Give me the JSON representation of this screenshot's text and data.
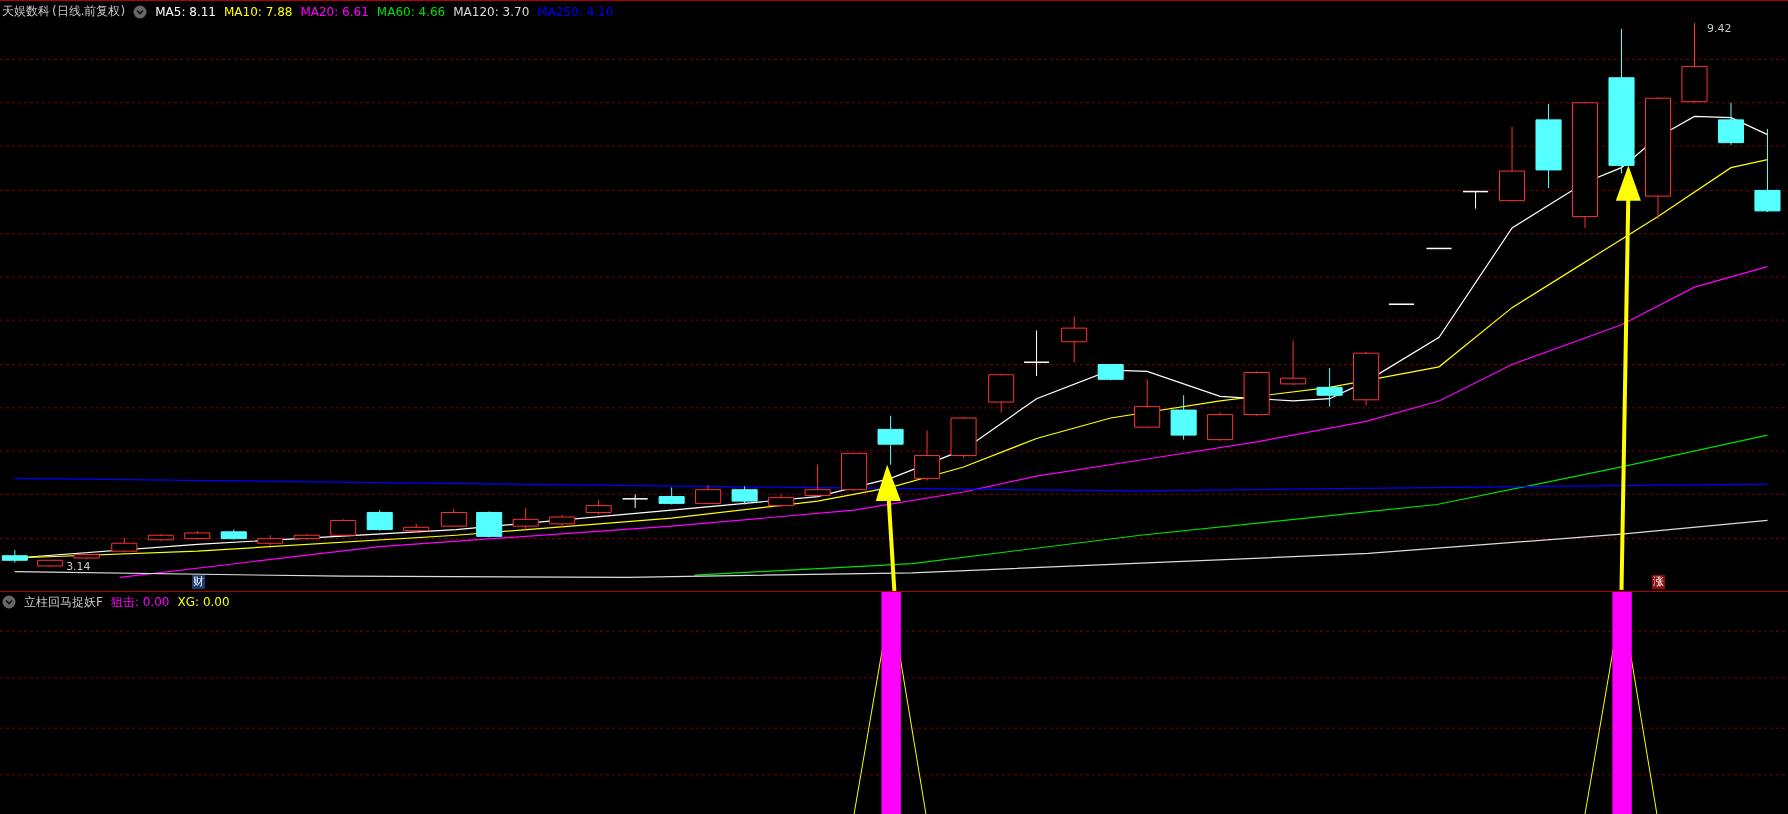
{
  "header": {
    "title": "天娱数科",
    "period": "(日线.前复权)",
    "averages": [
      {
        "label": "MA5:",
        "value": "8.11",
        "color": "#ffffff"
      },
      {
        "label": "MA10:",
        "value": "7.88",
        "color": "#ffff00"
      },
      {
        "label": "MA20:",
        "value": "6.61",
        "color": "#ff00ff"
      },
      {
        "label": "MA60:",
        "value": "4.66",
        "color": "#00e000"
      },
      {
        "label": "MA120:",
        "value": "3.70",
        "color": "#dcdcdc"
      },
      {
        "label": "MA250:",
        "value": "4.10",
        "color": "#0000ff"
      }
    ]
  },
  "main_chart": {
    "high_label": "9.42",
    "low_label": "3.14",
    "signals": [
      {
        "text": "财",
        "kind": "finance"
      },
      {
        "text": "涨",
        "kind": "rise"
      }
    ]
  },
  "indicator": {
    "name": "立柱回马捉妖F",
    "readouts": [
      {
        "label": "狙击:",
        "value": "0.00",
        "color": "#ff00ff"
      },
      {
        "label": "XG:",
        "value": "0.00",
        "color": "#ffff00"
      }
    ]
  }
}
